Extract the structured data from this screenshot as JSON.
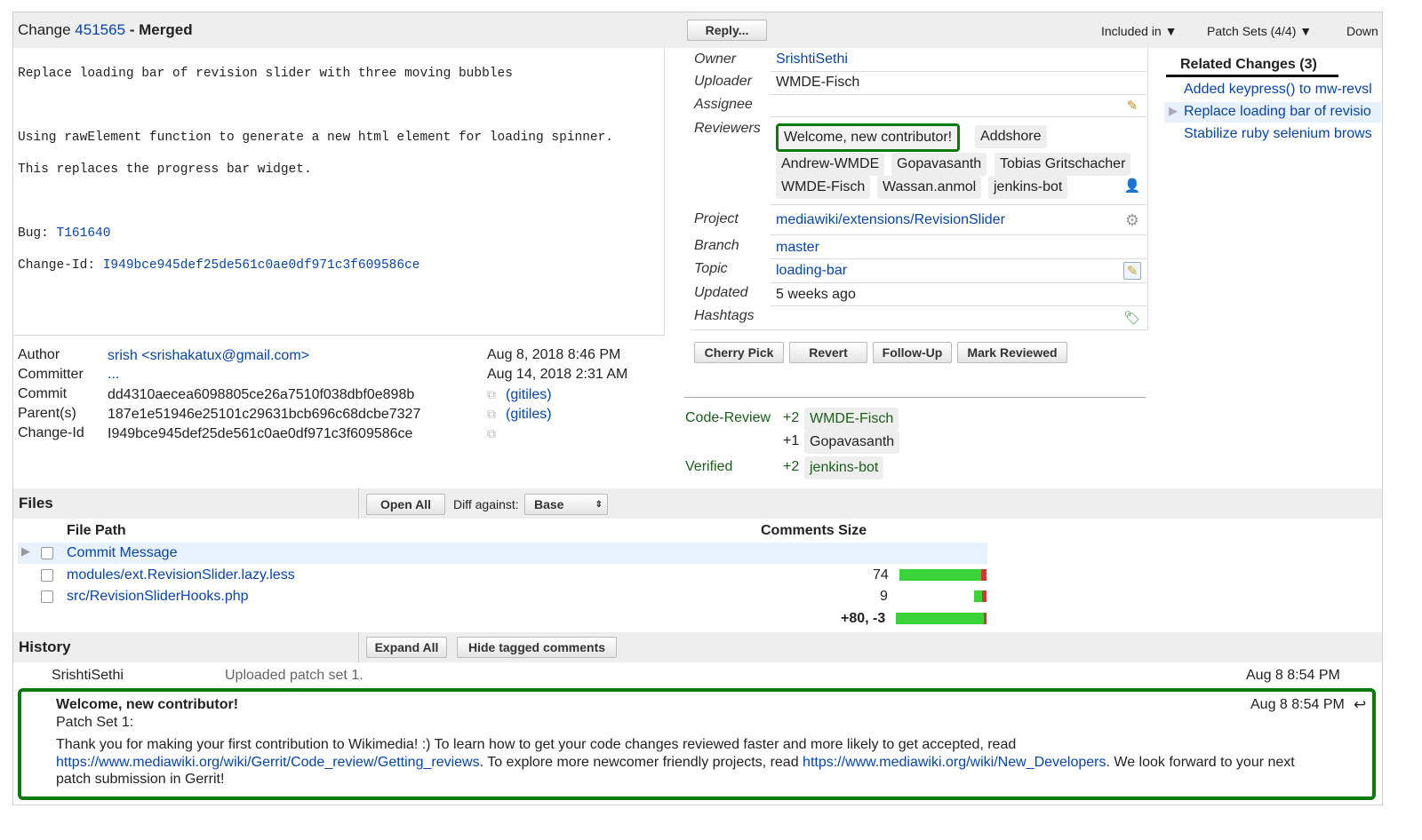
{
  "header": {
    "change_label": "Change",
    "change_number": "451565",
    "status": "- Merged",
    "reply_button": "Reply...",
    "included_in": "Included in ▼",
    "patch_sets": "Patch Sets (4/4) ▼",
    "download": "Down"
  },
  "commit_message": {
    "line1": "Replace loading bar of revision slider with three moving bubbles",
    "line2": "Using rawElement function to generate a new html element for loading spinner.",
    "line3": "This replaces the progress bar widget.",
    "bug_label": "Bug:",
    "bug_link": "T161640",
    "changeid_label": "Change-Id:",
    "changeid_link": "I949bce945def25de561c0ae0df971c3f609586ce"
  },
  "info": {
    "owner_label": "Owner",
    "owner": "SrishtiSethi",
    "uploader_label": "Uploader",
    "uploader": "WMDE-Fisch",
    "assignee_label": "Assignee",
    "reviewers_label": "Reviewers",
    "reviewers": [
      "Welcome, new contributor!",
      "Addshore",
      "Andrew-WMDE",
      "Gopavasanth",
      "Tobias Gritschacher",
      "WMDE-Fisch",
      "Wassan.anmol",
      "jenkins-bot"
    ],
    "project_label": "Project",
    "project": "mediawiki/extensions/RevisionSlider",
    "branch_label": "Branch",
    "branch": "master",
    "topic_label": "Topic",
    "topic": "loading-bar",
    "updated_label": "Updated",
    "updated": "5 weeks ago",
    "hashtags_label": "Hashtags"
  },
  "actions": {
    "cherry_pick": "Cherry Pick",
    "revert": "Revert",
    "follow_up": "Follow-Up",
    "mark_reviewed": "Mark Reviewed"
  },
  "votes": {
    "code_review_label": "Code-Review",
    "cr1_score": "+2",
    "cr1_user": "WMDE-Fisch",
    "cr2_score": "+1",
    "cr2_user": "Gopavasanth",
    "verified_label": "Verified",
    "v_score": "+2",
    "v_user": "jenkins-bot"
  },
  "related": {
    "title": "Related Changes (3)",
    "items": [
      "Added keypress() to mw-revsl",
      "Replace loading bar of revisio",
      "Stabilize ruby selenium brows"
    ]
  },
  "commit_info": {
    "author_label": "Author",
    "author": "srish <srishakatux@gmail.com>",
    "author_date": "Aug 8, 2018 8:46 PM",
    "committer_label": "Committer",
    "committer": "...",
    "committer_date": "Aug 14, 2018 2:31 AM",
    "commit_label": "Commit",
    "commit": "dd4310aecea6098805ce26a7510f038dbf0e898b",
    "commit_link": "(gitiles)",
    "parent_label": "Parent(s)",
    "parent": "187e1e51946e25101c29631bcb696c68dcbe7327",
    "parent_link": "(gitiles)",
    "changeid_label": "Change-Id",
    "changeid": "I949bce945def25de561c0ae0df971c3f609586ce"
  },
  "files": {
    "title": "Files",
    "open_all": "Open All",
    "diff_against_label": "Diff against:",
    "diff_against_value": "Base",
    "col_path": "File Path",
    "col_comments_size": "Comments Size",
    "rows": [
      {
        "path": "Commit Message",
        "size": ""
      },
      {
        "path": "modules/ext.RevisionSlider.lazy.less",
        "size": "74"
      },
      {
        "path": "src/RevisionSliderHooks.php",
        "size": "9"
      }
    ],
    "total": "+80, -3"
  },
  "history": {
    "title": "History",
    "expand_all": "Expand All",
    "hide_tagged": "Hide tagged comments",
    "entry1_author": "SrishtiSethi",
    "entry1_text": "Uploaded patch set 1.",
    "entry1_time": "Aug 8 8:54 PM",
    "entry2_author": "Welcome, new contributor!",
    "entry2_time": "Aug 8 8:54 PM",
    "entry2_patchset": "Patch Set 1:",
    "entry2_text1": "Thank you for making your first contribution to Wikimedia! :) To learn how to get your code changes reviewed faster and more likely to get accepted, read",
    "entry2_link1": "https://www.mediawiki.org/wiki/Gerrit/Code_review/Getting_reviews",
    "entry2_text2": ". To explore more newcomer friendly projects, read",
    "entry2_link2": "https://www.mediawiki.org/wiki/New_Developers",
    "entry2_text3": ". We look forward to your next",
    "entry2_text4": "patch submission in Gerrit!"
  },
  "colors": {
    "link": "#0645ad",
    "vote_green": "#1a5e1a",
    "highlight_border": "#0a7a0a",
    "size_bar_green": "#3ad43a",
    "size_bar_red": "#e23030"
  }
}
